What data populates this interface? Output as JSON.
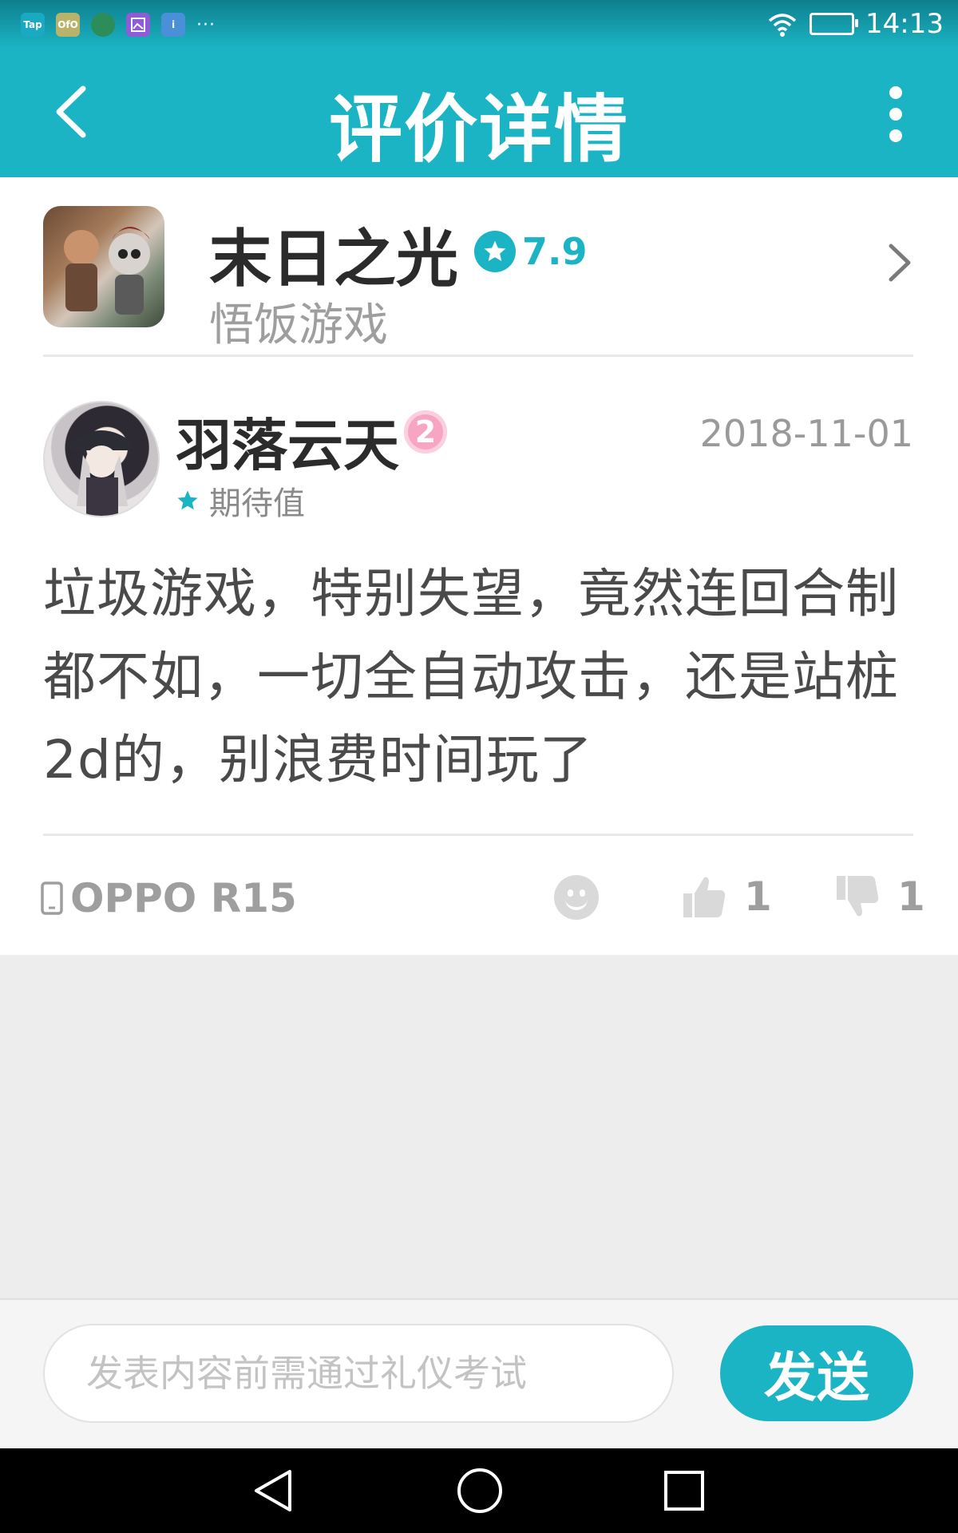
{
  "status_bar": {
    "time": "14:13",
    "notification_icons": [
      "Tap",
      "OfO",
      "",
      "",
      "i"
    ],
    "more_indicator": "···"
  },
  "header": {
    "title": "评价详情",
    "back_icon": "chevron-left-icon",
    "more_icon": "more-vertical-icon"
  },
  "game": {
    "name": "末日之光",
    "rating": "7.9",
    "developer": "悟饭游戏"
  },
  "review": {
    "user_name": "羽落云天",
    "level": "2",
    "date": "2018-11-01",
    "expectation_label": "期待值",
    "content": "垃圾游戏，特别失望，竟然连回合制都不如，一切全自动攻击，还是站桩2d的，别浪费时间玩了",
    "device": "OPPO R15",
    "likes": "1",
    "dislikes": "1"
  },
  "comment_bar": {
    "placeholder": "发表内容前需通过礼仪考试",
    "send_label": "发送"
  },
  "colors": {
    "accent": "#1bb4c4",
    "badge_pink": "#f7a5c2"
  }
}
